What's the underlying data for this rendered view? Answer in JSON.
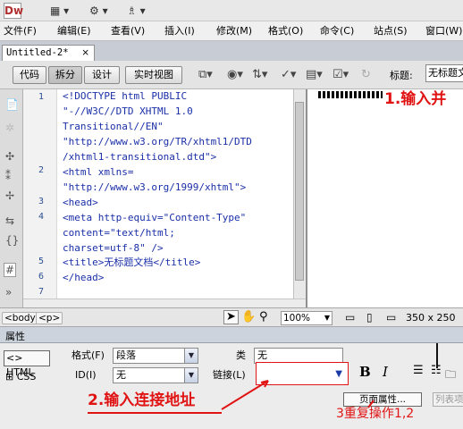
{
  "menu": [
    "文件(F)",
    "编辑(E)",
    "查看(V)",
    "插入(I)",
    "修改(M)",
    "格式(O)",
    "命令(C)",
    "站点(S)",
    "窗口(W)"
  ],
  "doc_tab": {
    "name": "Untitled-2*",
    "close": "×"
  },
  "views": {
    "code": "代码",
    "split": "拆分",
    "design": "设计",
    "live": "实时视图"
  },
  "title_label": "标题:",
  "title_value": "无标题文档",
  "line_numbers": [
    "1",
    "2",
    "3",
    "4",
    "5",
    "6",
    "7"
  ],
  "code_lines": [
    "<!DOCTYPE html PUBLIC",
    "\"-//W3C//DTD XHTML 1.0",
    "Transitional//EN\"",
    "\"http://www.w3.org/TR/xhtml1/DTD",
    "/xhtml1-transitional.dtd\">",
    "<html xmlns=",
    "\"http://www.w3.org/1999/xhtml\">",
    "<head>",
    "<meta http-equiv=\"Content-Type\"",
    "content=\"text/html;",
    "charset=utf-8\" />",
    "<title>无标题文档</title>",
    "</head>"
  ],
  "annotation_1": "1.输入并",
  "status": {
    "tag_body": "<body>",
    "tag_p": "<p>",
    "zoom": "100%",
    "size": "350 x 250"
  },
  "props": {
    "header": "属性",
    "html_btn": "HTML",
    "css_btn": "CSS",
    "format_label": "格式(F)",
    "format_value": "段落",
    "id_label": "ID(I)",
    "id_value": "无",
    "class_label": "类",
    "class_value": "无",
    "link_label": "链接(L)",
    "link_value": "",
    "bold": "B",
    "italic": "I",
    "page_props": "页面属性...",
    "list_item": "列表项"
  },
  "annotation_2": "2.输入连接地址",
  "annotation_3": "3重复操作1,2"
}
